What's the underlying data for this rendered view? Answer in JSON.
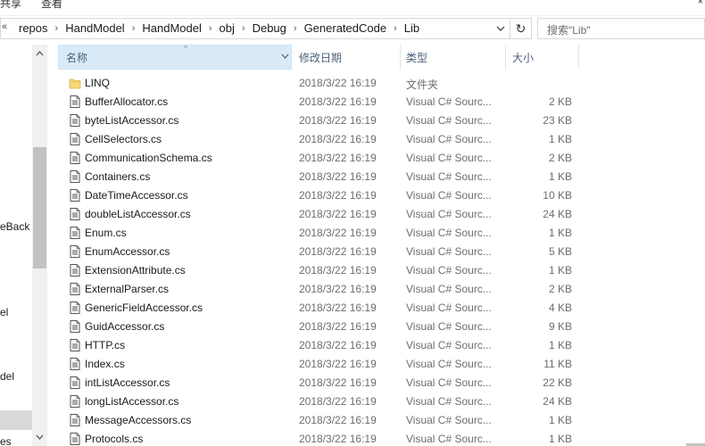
{
  "ribbon": {
    "tabs": [
      "共享",
      "查看"
    ],
    "close_glyph": "×"
  },
  "address": {
    "overflow": "«",
    "crumbs": [
      "repos",
      "HandModel",
      "HandModel",
      "obj",
      "Debug",
      "GeneratedCode",
      "Lib"
    ],
    "separator": "›",
    "refresh_glyph": "↻"
  },
  "search": {
    "placeholder": "搜索\"Lib\""
  },
  "nav": {
    "items": [
      "eBack",
      "el",
      "del",
      "es"
    ]
  },
  "columns": {
    "name": "名称",
    "date": "修改日期",
    "type": "类型",
    "size": "大小",
    "name_sort_caret": "^"
  },
  "files": [
    {
      "name": "LINQ",
      "date": "2018/3/22 16:19",
      "type": "文件夹",
      "size": "",
      "icon": "folder-icon"
    },
    {
      "name": "BufferAllocator.cs",
      "date": "2018/3/22 16:19",
      "type": "Visual C# Sourc...",
      "size": "2 KB",
      "icon": "cs-file-icon"
    },
    {
      "name": "byteListAccessor.cs",
      "date": "2018/3/22 16:19",
      "type": "Visual C# Sourc...",
      "size": "23 KB",
      "icon": "cs-file-icon"
    },
    {
      "name": "CellSelectors.cs",
      "date": "2018/3/22 16:19",
      "type": "Visual C# Sourc...",
      "size": "1 KB",
      "icon": "cs-file-icon"
    },
    {
      "name": "CommunicationSchema.cs",
      "date": "2018/3/22 16:19",
      "type": "Visual C# Sourc...",
      "size": "2 KB",
      "icon": "cs-file-icon"
    },
    {
      "name": "Containers.cs",
      "date": "2018/3/22 16:19",
      "type": "Visual C# Sourc...",
      "size": "1 KB",
      "icon": "cs-file-icon"
    },
    {
      "name": "DateTimeAccessor.cs",
      "date": "2018/3/22 16:19",
      "type": "Visual C# Sourc...",
      "size": "10 KB",
      "icon": "cs-file-icon"
    },
    {
      "name": "doubleListAccessor.cs",
      "date": "2018/3/22 16:19",
      "type": "Visual C# Sourc...",
      "size": "24 KB",
      "icon": "cs-file-icon"
    },
    {
      "name": "Enum.cs",
      "date": "2018/3/22 16:19",
      "type": "Visual C# Sourc...",
      "size": "1 KB",
      "icon": "cs-file-icon"
    },
    {
      "name": "EnumAccessor.cs",
      "date": "2018/3/22 16:19",
      "type": "Visual C# Sourc...",
      "size": "5 KB",
      "icon": "cs-file-icon"
    },
    {
      "name": "ExtensionAttribute.cs",
      "date": "2018/3/22 16:19",
      "type": "Visual C# Sourc...",
      "size": "1 KB",
      "icon": "cs-file-icon"
    },
    {
      "name": "ExternalParser.cs",
      "date": "2018/3/22 16:19",
      "type": "Visual C# Sourc...",
      "size": "2 KB",
      "icon": "cs-file-icon"
    },
    {
      "name": "GenericFieldAccessor.cs",
      "date": "2018/3/22 16:19",
      "type": "Visual C# Sourc...",
      "size": "4 KB",
      "icon": "cs-file-icon"
    },
    {
      "name": "GuidAccessor.cs",
      "date": "2018/3/22 16:19",
      "type": "Visual C# Sourc...",
      "size": "9 KB",
      "icon": "cs-file-icon"
    },
    {
      "name": "HTTP.cs",
      "date": "2018/3/22 16:19",
      "type": "Visual C# Sourc...",
      "size": "1 KB",
      "icon": "cs-file-icon"
    },
    {
      "name": "Index.cs",
      "date": "2018/3/22 16:19",
      "type": "Visual C# Sourc...",
      "size": "11 KB",
      "icon": "cs-file-icon"
    },
    {
      "name": "intListAccessor.cs",
      "date": "2018/3/22 16:19",
      "type": "Visual C# Sourc...",
      "size": "22 KB",
      "icon": "cs-file-icon"
    },
    {
      "name": "longListAccessor.cs",
      "date": "2018/3/22 16:19",
      "type": "Visual C# Sourc...",
      "size": "24 KB",
      "icon": "cs-file-icon"
    },
    {
      "name": "MessageAccessors.cs",
      "date": "2018/3/22 16:19",
      "type": "Visual C# Sourc...",
      "size": "1 KB",
      "icon": "cs-file-icon"
    },
    {
      "name": "Protocols.cs",
      "date": "2018/3/22 16:19",
      "type": "Visual C# Sourc...",
      "size": "1 KB",
      "icon": "cs-file-icon"
    }
  ],
  "colors": {
    "header_selected": "#d9ebf9",
    "header_text": "#4c607a",
    "folder": "#f8d775",
    "muted_text": "#6d6d6d"
  }
}
